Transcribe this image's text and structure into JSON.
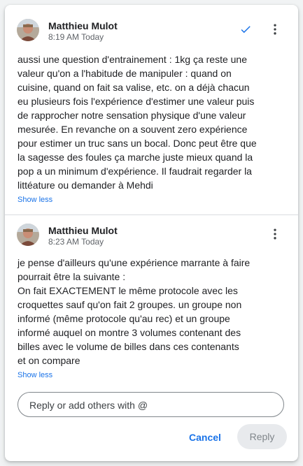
{
  "comments": [
    {
      "author": "Matthieu Mulot",
      "time": "8:19 AM Today",
      "resolved_icon": "check-icon",
      "lines": [
        "aussi une question d'entrainement : 1kg ça reste une",
        "valeur qu'on a l'habitude de manipuler : quand on",
        "cuisine, quand on fait sa valise, etc. on a déjà chacun",
        "eu plusieurs fois l'expérience d'estimer une valeur puis",
        "de rapprocher notre sensation physique d'une valeur",
        "mesurée. En revanche on a souvent zero expérience",
        "pour estimer un truc sans un bocal. Donc peut être que",
        "la sagesse des foules ça marche juste mieux quand la",
        "pop a un minimum d'expérience. Il faudrait regarder la",
        "littéature ou demander à Mehdi"
      ],
      "show_less": "Show less"
    },
    {
      "author": "Matthieu Mulot",
      "time": "8:23 AM Today",
      "lines": [
        "je pense d'ailleurs qu'une expérience marrante à faire",
        "pourrait être la suivante :",
        "On fait EXACTEMENT le même protocole avec les",
        "croquettes sauf qu'on fait 2 groupes. un groupe non",
        "informé (même protocole qu'au rec) et un groupe",
        "informé auquel on montre 3 volumes contenant des",
        "billes avec le volume de billes dans ces contenants",
        "et on compare"
      ],
      "show_less": "Show less"
    }
  ],
  "reply": {
    "placeholder": "Reply or add others with @",
    "cancel_label": "Cancel",
    "reply_label": "Reply"
  },
  "colors": {
    "accent": "#1a73e8",
    "text": "#202124",
    "muted": "#5f6368"
  }
}
